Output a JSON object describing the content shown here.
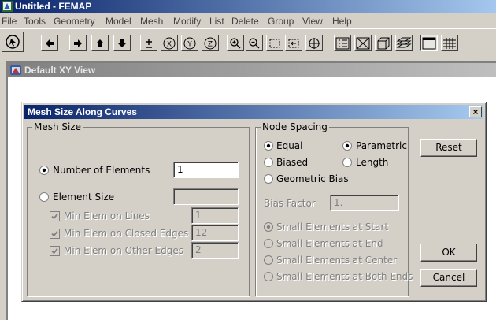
{
  "app": {
    "title": "Untitled - FEMAP"
  },
  "menu": [
    "File",
    "Tools",
    "Geometry",
    "Model",
    "Mesh",
    "Modify",
    "List",
    "Delete",
    "Group",
    "View",
    "Help"
  ],
  "toolbar": {
    "icons": [
      "select-icon",
      "arrow-left-icon",
      "arrow-right-icon",
      "arrow-up-icon",
      "arrow-down-icon",
      "plus-minus-icon",
      "rotate-x-icon",
      "rotate-y-icon",
      "rotate-z-icon",
      "zoom-in-icon",
      "zoom-out-icon",
      "zoom-box-icon",
      "pan-icon",
      "center-icon",
      "list-icon",
      "box-icon",
      "solid-icon",
      "layers-icon",
      "window-icon",
      "grid-icon"
    ],
    "rotate_labels": [
      "X",
      "Y",
      "Z"
    ]
  },
  "view": {
    "title": "Default XY View"
  },
  "dialog": {
    "title": "Mesh Size Along Curves",
    "close_glyph": "×",
    "mesh_size": {
      "label": "Mesh Size",
      "number_of_elements": {
        "label": "Number of Elements",
        "value": "1",
        "selected": true
      },
      "element_size": {
        "label": "Element Size",
        "value": "",
        "selected": false
      },
      "min_lines": {
        "label": "Min Elem on Lines",
        "value": "1",
        "checked": true
      },
      "min_closed": {
        "label": "Min Elem on Closed Edges",
        "value": "12",
        "checked": true
      },
      "min_other": {
        "label": "Min Elem on Other Edges",
        "value": "2",
        "checked": true
      }
    },
    "node_spacing": {
      "label": "Node Spacing",
      "equal": "Equal",
      "biased": "Biased",
      "geometric": "Geometric Bias",
      "parametric": "Parametric",
      "length": "Length",
      "bias_factor_label": "Bias Factor",
      "bias_factor_value": "1.",
      "small_start": "Small Elements at Start",
      "small_end": "Small Elements at End",
      "small_center": "Small Elements at Center",
      "small_both": "Small Elements at Both Ends"
    },
    "buttons": {
      "reset": "Reset",
      "ok": "OK",
      "cancel": "Cancel"
    }
  }
}
